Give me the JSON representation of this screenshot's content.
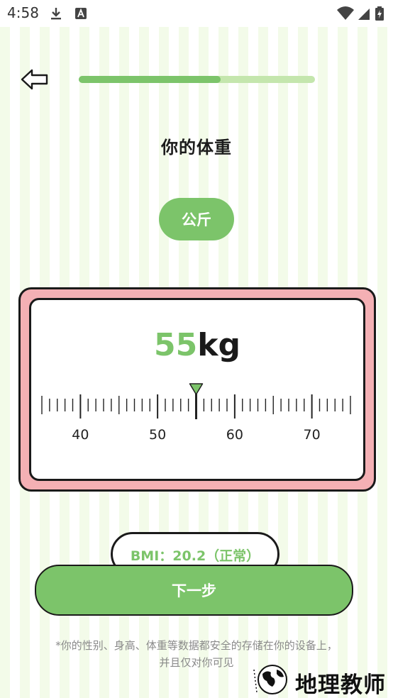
{
  "status_bar": {
    "time": "4:58",
    "icons": [
      "download-icon",
      "text-a-icon",
      "wifi-icon",
      "signal-icon",
      "battery-charging-icon"
    ]
  },
  "header": {
    "back_icon": "arrow-left-outline-icon",
    "progress": 0.6
  },
  "page": {
    "title": "你的体重",
    "unit_label": "公斤"
  },
  "scale": {
    "value": "55",
    "unit": "kg",
    "min": 35,
    "max": 75,
    "selected": 55,
    "tick_labels": [
      "40",
      "50",
      "60",
      "70"
    ],
    "colors": {
      "frame": "#f4b0b4",
      "accent": "#7cc46a"
    }
  },
  "bmi": {
    "label": "BMI：20.2（正常）"
  },
  "actions": {
    "next_label": "下一步"
  },
  "footer": {
    "privacy_line1": "*你的性别、身高、体重等数据都安全的存储在你的设备上，",
    "privacy_line2": "并且仅对你可见"
  },
  "watermark": {
    "text": "地理教师"
  },
  "colors": {
    "accent": "#7cc46a",
    "accent_light": "#c4e6ad",
    "stripe": "#f3fbe9",
    "text_dark": "#1c1c1c"
  }
}
